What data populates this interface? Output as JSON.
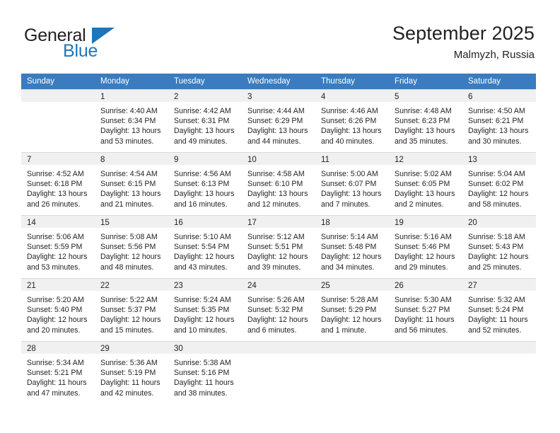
{
  "brand": {
    "name_part1": "General",
    "name_part2": "Blue",
    "triangle_color": "#1c76bc",
    "text_color": "#231f20"
  },
  "header": {
    "title": "September 2025",
    "subtitle": "Malmyzh, Russia",
    "header_bg": "#3a7cbf",
    "daynum_bg": "#f0f0f0"
  },
  "weekdays": [
    "Sunday",
    "Monday",
    "Tuesday",
    "Wednesday",
    "Thursday",
    "Friday",
    "Saturday"
  ],
  "weeks": [
    [
      {
        "day": "",
        "lines": []
      },
      {
        "day": "1",
        "lines": [
          "Sunrise: 4:40 AM",
          "Sunset: 6:34 PM",
          "Daylight: 13 hours",
          "and 53 minutes."
        ]
      },
      {
        "day": "2",
        "lines": [
          "Sunrise: 4:42 AM",
          "Sunset: 6:31 PM",
          "Daylight: 13 hours",
          "and 49 minutes."
        ]
      },
      {
        "day": "3",
        "lines": [
          "Sunrise: 4:44 AM",
          "Sunset: 6:29 PM",
          "Daylight: 13 hours",
          "and 44 minutes."
        ]
      },
      {
        "day": "4",
        "lines": [
          "Sunrise: 4:46 AM",
          "Sunset: 6:26 PM",
          "Daylight: 13 hours",
          "and 40 minutes."
        ]
      },
      {
        "day": "5",
        "lines": [
          "Sunrise: 4:48 AM",
          "Sunset: 6:23 PM",
          "Daylight: 13 hours",
          "and 35 minutes."
        ]
      },
      {
        "day": "6",
        "lines": [
          "Sunrise: 4:50 AM",
          "Sunset: 6:21 PM",
          "Daylight: 13 hours",
          "and 30 minutes."
        ]
      }
    ],
    [
      {
        "day": "7",
        "lines": [
          "Sunrise: 4:52 AM",
          "Sunset: 6:18 PM",
          "Daylight: 13 hours",
          "and 26 minutes."
        ]
      },
      {
        "day": "8",
        "lines": [
          "Sunrise: 4:54 AM",
          "Sunset: 6:15 PM",
          "Daylight: 13 hours",
          "and 21 minutes."
        ]
      },
      {
        "day": "9",
        "lines": [
          "Sunrise: 4:56 AM",
          "Sunset: 6:13 PM",
          "Daylight: 13 hours",
          "and 16 minutes."
        ]
      },
      {
        "day": "10",
        "lines": [
          "Sunrise: 4:58 AM",
          "Sunset: 6:10 PM",
          "Daylight: 13 hours",
          "and 12 minutes."
        ]
      },
      {
        "day": "11",
        "lines": [
          "Sunrise: 5:00 AM",
          "Sunset: 6:07 PM",
          "Daylight: 13 hours",
          "and 7 minutes."
        ]
      },
      {
        "day": "12",
        "lines": [
          "Sunrise: 5:02 AM",
          "Sunset: 6:05 PM",
          "Daylight: 13 hours",
          "and 2 minutes."
        ]
      },
      {
        "day": "13",
        "lines": [
          "Sunrise: 5:04 AM",
          "Sunset: 6:02 PM",
          "Daylight: 12 hours",
          "and 58 minutes."
        ]
      }
    ],
    [
      {
        "day": "14",
        "lines": [
          "Sunrise: 5:06 AM",
          "Sunset: 5:59 PM",
          "Daylight: 12 hours",
          "and 53 minutes."
        ]
      },
      {
        "day": "15",
        "lines": [
          "Sunrise: 5:08 AM",
          "Sunset: 5:56 PM",
          "Daylight: 12 hours",
          "and 48 minutes."
        ]
      },
      {
        "day": "16",
        "lines": [
          "Sunrise: 5:10 AM",
          "Sunset: 5:54 PM",
          "Daylight: 12 hours",
          "and 43 minutes."
        ]
      },
      {
        "day": "17",
        "lines": [
          "Sunrise: 5:12 AM",
          "Sunset: 5:51 PM",
          "Daylight: 12 hours",
          "and 39 minutes."
        ]
      },
      {
        "day": "18",
        "lines": [
          "Sunrise: 5:14 AM",
          "Sunset: 5:48 PM",
          "Daylight: 12 hours",
          "and 34 minutes."
        ]
      },
      {
        "day": "19",
        "lines": [
          "Sunrise: 5:16 AM",
          "Sunset: 5:46 PM",
          "Daylight: 12 hours",
          "and 29 minutes."
        ]
      },
      {
        "day": "20",
        "lines": [
          "Sunrise: 5:18 AM",
          "Sunset: 5:43 PM",
          "Daylight: 12 hours",
          "and 25 minutes."
        ]
      }
    ],
    [
      {
        "day": "21",
        "lines": [
          "Sunrise: 5:20 AM",
          "Sunset: 5:40 PM",
          "Daylight: 12 hours",
          "and 20 minutes."
        ]
      },
      {
        "day": "22",
        "lines": [
          "Sunrise: 5:22 AM",
          "Sunset: 5:37 PM",
          "Daylight: 12 hours",
          "and 15 minutes."
        ]
      },
      {
        "day": "23",
        "lines": [
          "Sunrise: 5:24 AM",
          "Sunset: 5:35 PM",
          "Daylight: 12 hours",
          "and 10 minutes."
        ]
      },
      {
        "day": "24",
        "lines": [
          "Sunrise: 5:26 AM",
          "Sunset: 5:32 PM",
          "Daylight: 12 hours",
          "and 6 minutes."
        ]
      },
      {
        "day": "25",
        "lines": [
          "Sunrise: 5:28 AM",
          "Sunset: 5:29 PM",
          "Daylight: 12 hours",
          "and 1 minute."
        ]
      },
      {
        "day": "26",
        "lines": [
          "Sunrise: 5:30 AM",
          "Sunset: 5:27 PM",
          "Daylight: 11 hours",
          "and 56 minutes."
        ]
      },
      {
        "day": "27",
        "lines": [
          "Sunrise: 5:32 AM",
          "Sunset: 5:24 PM",
          "Daylight: 11 hours",
          "and 52 minutes."
        ]
      }
    ],
    [
      {
        "day": "28",
        "lines": [
          "Sunrise: 5:34 AM",
          "Sunset: 5:21 PM",
          "Daylight: 11 hours",
          "and 47 minutes."
        ]
      },
      {
        "day": "29",
        "lines": [
          "Sunrise: 5:36 AM",
          "Sunset: 5:19 PM",
          "Daylight: 11 hours",
          "and 42 minutes."
        ]
      },
      {
        "day": "30",
        "lines": [
          "Sunrise: 5:38 AM",
          "Sunset: 5:16 PM",
          "Daylight: 11 hours",
          "and 38 minutes."
        ]
      },
      {
        "day": "",
        "lines": []
      },
      {
        "day": "",
        "lines": []
      },
      {
        "day": "",
        "lines": []
      },
      {
        "day": "",
        "lines": []
      }
    ]
  ]
}
